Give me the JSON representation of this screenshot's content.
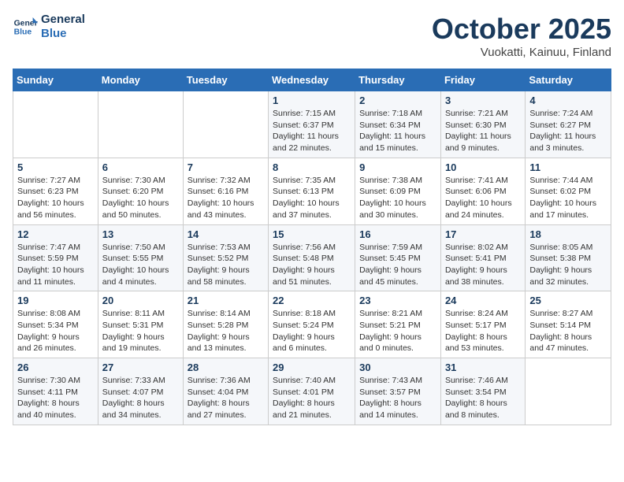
{
  "header": {
    "logo_line1": "General",
    "logo_line2": "Blue",
    "month": "October 2025",
    "location": "Vuokatti, Kainuu, Finland"
  },
  "weekdays": [
    "Sunday",
    "Monday",
    "Tuesday",
    "Wednesday",
    "Thursday",
    "Friday",
    "Saturday"
  ],
  "weeks": [
    [
      {
        "day": "",
        "info": ""
      },
      {
        "day": "",
        "info": ""
      },
      {
        "day": "",
        "info": ""
      },
      {
        "day": "1",
        "info": "Sunrise: 7:15 AM\nSunset: 6:37 PM\nDaylight: 11 hours\nand 22 minutes."
      },
      {
        "day": "2",
        "info": "Sunrise: 7:18 AM\nSunset: 6:34 PM\nDaylight: 11 hours\nand 15 minutes."
      },
      {
        "day": "3",
        "info": "Sunrise: 7:21 AM\nSunset: 6:30 PM\nDaylight: 11 hours\nand 9 minutes."
      },
      {
        "day": "4",
        "info": "Sunrise: 7:24 AM\nSunset: 6:27 PM\nDaylight: 11 hours\nand 3 minutes."
      }
    ],
    [
      {
        "day": "5",
        "info": "Sunrise: 7:27 AM\nSunset: 6:23 PM\nDaylight: 10 hours\nand 56 minutes."
      },
      {
        "day": "6",
        "info": "Sunrise: 7:30 AM\nSunset: 6:20 PM\nDaylight: 10 hours\nand 50 minutes."
      },
      {
        "day": "7",
        "info": "Sunrise: 7:32 AM\nSunset: 6:16 PM\nDaylight: 10 hours\nand 43 minutes."
      },
      {
        "day": "8",
        "info": "Sunrise: 7:35 AM\nSunset: 6:13 PM\nDaylight: 10 hours\nand 37 minutes."
      },
      {
        "day": "9",
        "info": "Sunrise: 7:38 AM\nSunset: 6:09 PM\nDaylight: 10 hours\nand 30 minutes."
      },
      {
        "day": "10",
        "info": "Sunrise: 7:41 AM\nSunset: 6:06 PM\nDaylight: 10 hours\nand 24 minutes."
      },
      {
        "day": "11",
        "info": "Sunrise: 7:44 AM\nSunset: 6:02 PM\nDaylight: 10 hours\nand 17 minutes."
      }
    ],
    [
      {
        "day": "12",
        "info": "Sunrise: 7:47 AM\nSunset: 5:59 PM\nDaylight: 10 hours\nand 11 minutes."
      },
      {
        "day": "13",
        "info": "Sunrise: 7:50 AM\nSunset: 5:55 PM\nDaylight: 10 hours\nand 4 minutes."
      },
      {
        "day": "14",
        "info": "Sunrise: 7:53 AM\nSunset: 5:52 PM\nDaylight: 9 hours\nand 58 minutes."
      },
      {
        "day": "15",
        "info": "Sunrise: 7:56 AM\nSunset: 5:48 PM\nDaylight: 9 hours\nand 51 minutes."
      },
      {
        "day": "16",
        "info": "Sunrise: 7:59 AM\nSunset: 5:45 PM\nDaylight: 9 hours\nand 45 minutes."
      },
      {
        "day": "17",
        "info": "Sunrise: 8:02 AM\nSunset: 5:41 PM\nDaylight: 9 hours\nand 38 minutes."
      },
      {
        "day": "18",
        "info": "Sunrise: 8:05 AM\nSunset: 5:38 PM\nDaylight: 9 hours\nand 32 minutes."
      }
    ],
    [
      {
        "day": "19",
        "info": "Sunrise: 8:08 AM\nSunset: 5:34 PM\nDaylight: 9 hours\nand 26 minutes."
      },
      {
        "day": "20",
        "info": "Sunrise: 8:11 AM\nSunset: 5:31 PM\nDaylight: 9 hours\nand 19 minutes."
      },
      {
        "day": "21",
        "info": "Sunrise: 8:14 AM\nSunset: 5:28 PM\nDaylight: 9 hours\nand 13 minutes."
      },
      {
        "day": "22",
        "info": "Sunrise: 8:18 AM\nSunset: 5:24 PM\nDaylight: 9 hours\nand 6 minutes."
      },
      {
        "day": "23",
        "info": "Sunrise: 8:21 AM\nSunset: 5:21 PM\nDaylight: 9 hours\nand 0 minutes."
      },
      {
        "day": "24",
        "info": "Sunrise: 8:24 AM\nSunset: 5:17 PM\nDaylight: 8 hours\nand 53 minutes."
      },
      {
        "day": "25",
        "info": "Sunrise: 8:27 AM\nSunset: 5:14 PM\nDaylight: 8 hours\nand 47 minutes."
      }
    ],
    [
      {
        "day": "26",
        "info": "Sunrise: 7:30 AM\nSunset: 4:11 PM\nDaylight: 8 hours\nand 40 minutes."
      },
      {
        "day": "27",
        "info": "Sunrise: 7:33 AM\nSunset: 4:07 PM\nDaylight: 8 hours\nand 34 minutes."
      },
      {
        "day": "28",
        "info": "Sunrise: 7:36 AM\nSunset: 4:04 PM\nDaylight: 8 hours\nand 27 minutes."
      },
      {
        "day": "29",
        "info": "Sunrise: 7:40 AM\nSunset: 4:01 PM\nDaylight: 8 hours\nand 21 minutes."
      },
      {
        "day": "30",
        "info": "Sunrise: 7:43 AM\nSunset: 3:57 PM\nDaylight: 8 hours\nand 14 minutes."
      },
      {
        "day": "31",
        "info": "Sunrise: 7:46 AM\nSunset: 3:54 PM\nDaylight: 8 hours\nand 8 minutes."
      },
      {
        "day": "",
        "info": ""
      }
    ]
  ]
}
